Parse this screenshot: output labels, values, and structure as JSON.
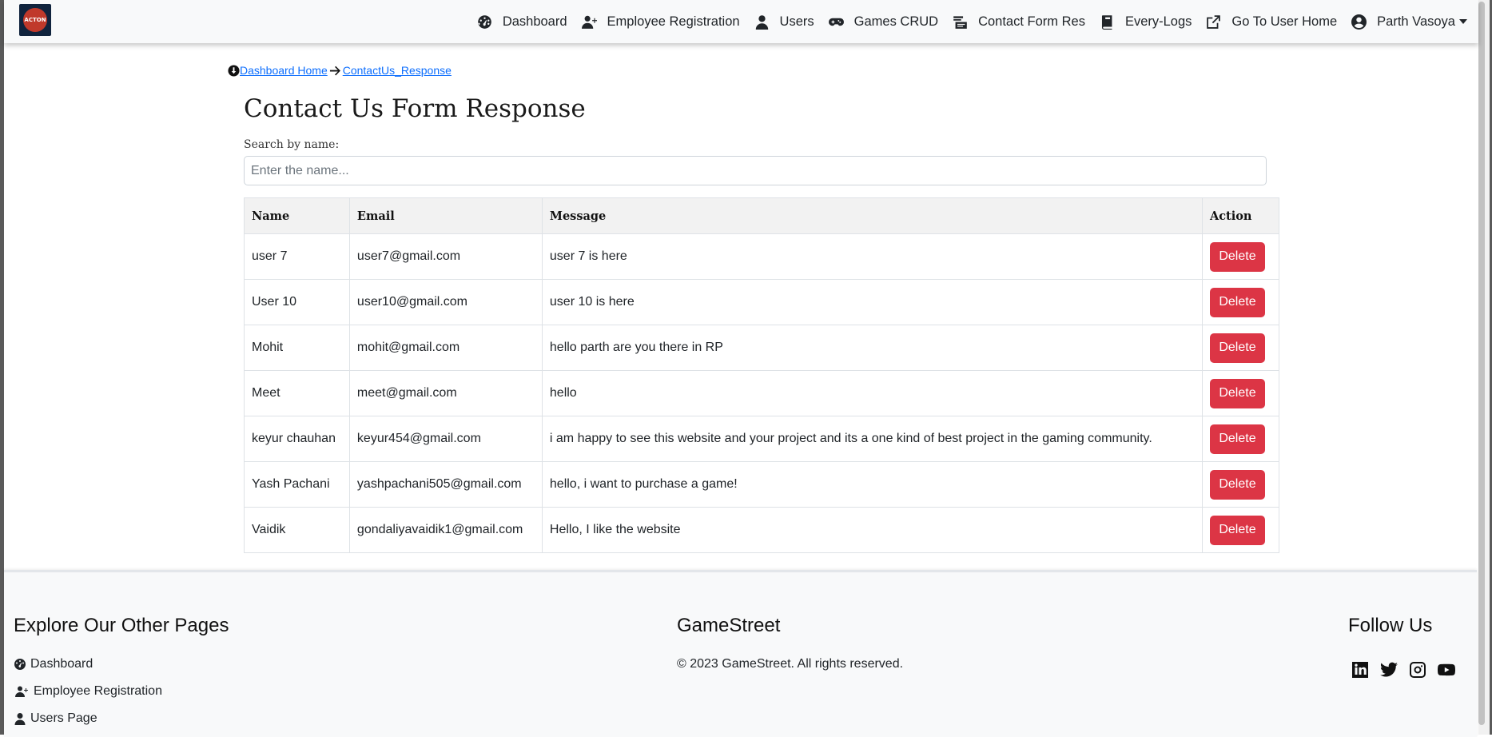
{
  "navbar": {
    "logo_text": "ACTON",
    "items": [
      {
        "label": "Dashboard",
        "icon": "dashboard-gauge-icon"
      },
      {
        "label": "Employee Registration",
        "icon": "user-plus-icon"
      },
      {
        "label": "Users",
        "icon": "user-icon"
      },
      {
        "label": "Games CRUD",
        "icon": "gamepad-icon"
      },
      {
        "label": "Contact Form Res",
        "icon": "contact-card-icon"
      },
      {
        "label": "Every-Logs",
        "icon": "book-icon"
      },
      {
        "label": "Go To User Home",
        "icon": "external-link-icon"
      },
      {
        "label": "Parth Vasoya",
        "icon": "user-circle-icon"
      }
    ]
  },
  "breadcrumb": {
    "home_label": "Dashboard Home",
    "current_label": "ContactUs_Response"
  },
  "page": {
    "title": "Contact Us Form Response",
    "search_label": "Search by name:",
    "search_placeholder": "Enter the name..."
  },
  "table": {
    "headers": [
      "Name",
      "Email",
      "Message",
      "Action"
    ],
    "rows": [
      {
        "name": "user 7",
        "email": "user7@gmail.com",
        "message": "user 7 is here",
        "action": "Delete"
      },
      {
        "name": "User 10",
        "email": "user10@gmail.com",
        "message": "user 10 is here",
        "action": "Delete"
      },
      {
        "name": "Mohit",
        "email": "mohit@gmail.com",
        "message": "hello parth are you there in RP",
        "action": "Delete"
      },
      {
        "name": "Meet",
        "email": "meet@gmail.com",
        "message": "hello",
        "action": "Delete"
      },
      {
        "name": "keyur chauhan",
        "email": "keyur454@gmail.com",
        "message": "i am happy to see this website and your project and its a one kind of best project in the gaming community.",
        "action": "Delete"
      },
      {
        "name": "Yash Pachani",
        "email": "yashpachani505@gmail.com",
        "message": "hello, i want to purchase a game!",
        "action": "Delete"
      },
      {
        "name": "Vaidik",
        "email": "gondaliyavaidik1@gmail.com",
        "message": "Hello, I like the website",
        "action": "Delete"
      }
    ]
  },
  "footer": {
    "explore_title": "Explore Our Other Pages",
    "links": [
      {
        "label": "Dashboard",
        "icon": "dashboard-gauge-icon"
      },
      {
        "label": "Employee Registration",
        "icon": "user-plus-icon"
      },
      {
        "label": "Users Page",
        "icon": "user-icon"
      }
    ],
    "brand_title": "GameStreet",
    "copyright": "© 2023 GameStreet. All rights reserved.",
    "follow_title": "Follow Us",
    "social": [
      "linkedin-icon",
      "twitter-icon",
      "instagram-icon",
      "youtube-icon"
    ]
  },
  "colors": {
    "link": "#0d6efd",
    "danger": "#dc3545",
    "navbar_bg": "#f8f9fa"
  }
}
